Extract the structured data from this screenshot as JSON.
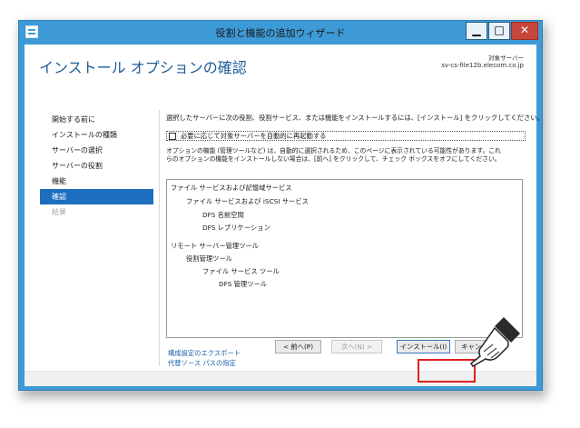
{
  "window": {
    "title": "役割と機能の追加ウィザード",
    "minimize": "▁",
    "maximize": "□",
    "close": "✕"
  },
  "header": {
    "title": "インストール オプションの確認",
    "destination_label": "対象サーバー",
    "destination_server": "sv-cs-file12b.elecom.co.jp"
  },
  "nav": {
    "items": [
      {
        "label": "開始する前に",
        "state": "normal"
      },
      {
        "label": "インストールの種類",
        "state": "normal"
      },
      {
        "label": "サーバーの選択",
        "state": "normal"
      },
      {
        "label": "サーバーの役割",
        "state": "normal"
      },
      {
        "label": "機能",
        "state": "normal"
      },
      {
        "label": "確認",
        "state": "active"
      },
      {
        "label": "結果",
        "state": "disabled"
      }
    ]
  },
  "main": {
    "intro": "選択したサーバーに次の役割、役割サービス、または機能をインストールするには、[インストール] をクリックしてください。",
    "restart_checkbox_label": "必要に応じて対象サーバーを自動的に再起動する",
    "note_line1": "オプションの機能 (管理ツールなど) は、自動的に選択されるため、このページに表示されている可能性があります。これ",
    "note_line2": "らのオプションの機能をインストールしない場合は、[前へ] をクリックして、チェック ボックスをオフにしてください。",
    "features": [
      "ファイル サービスおよび記憶域サービス",
      "ファイル サービスおよび iSCSI サービス",
      "DFS 名前空間",
      "DFS レプリケーション",
      "リモート サーバー管理ツール",
      "役割管理ツール",
      "ファイル サービス ツール",
      "DFS 管理ツール"
    ],
    "export_link": "構成設定のエクスポート",
    "alt_source_link": "代替ソース パスの指定"
  },
  "footer": {
    "prev": "< 前へ(P)",
    "next": "次へ(N) >",
    "install": "インストール(I)",
    "cancel": "キャンセル"
  },
  "colors": {
    "titlebar": "#3e9ad6",
    "accent": "#1d6ebe",
    "highlight": "#e02020"
  }
}
